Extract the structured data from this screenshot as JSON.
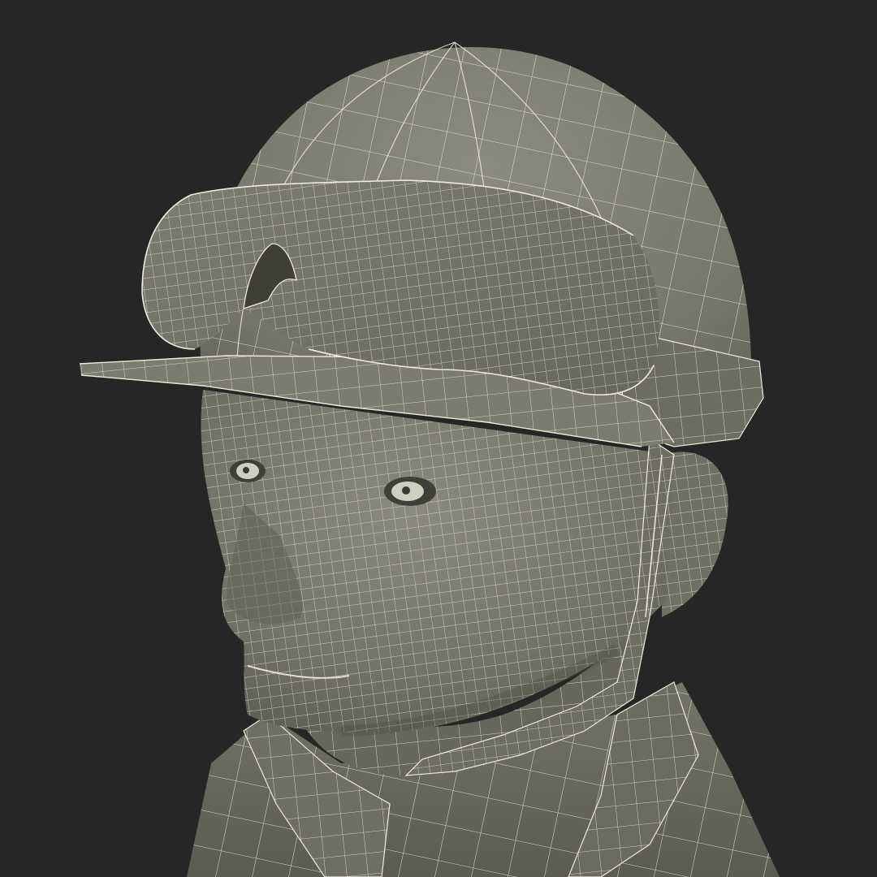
{
  "scene": {
    "subject": "worker-head-wireframe",
    "colors": {
      "background": "#262626",
      "surface_light": "#85857a",
      "surface_mid": "#707065",
      "surface_dark": "#55554c",
      "wire": "#ecebdc"
    }
  }
}
